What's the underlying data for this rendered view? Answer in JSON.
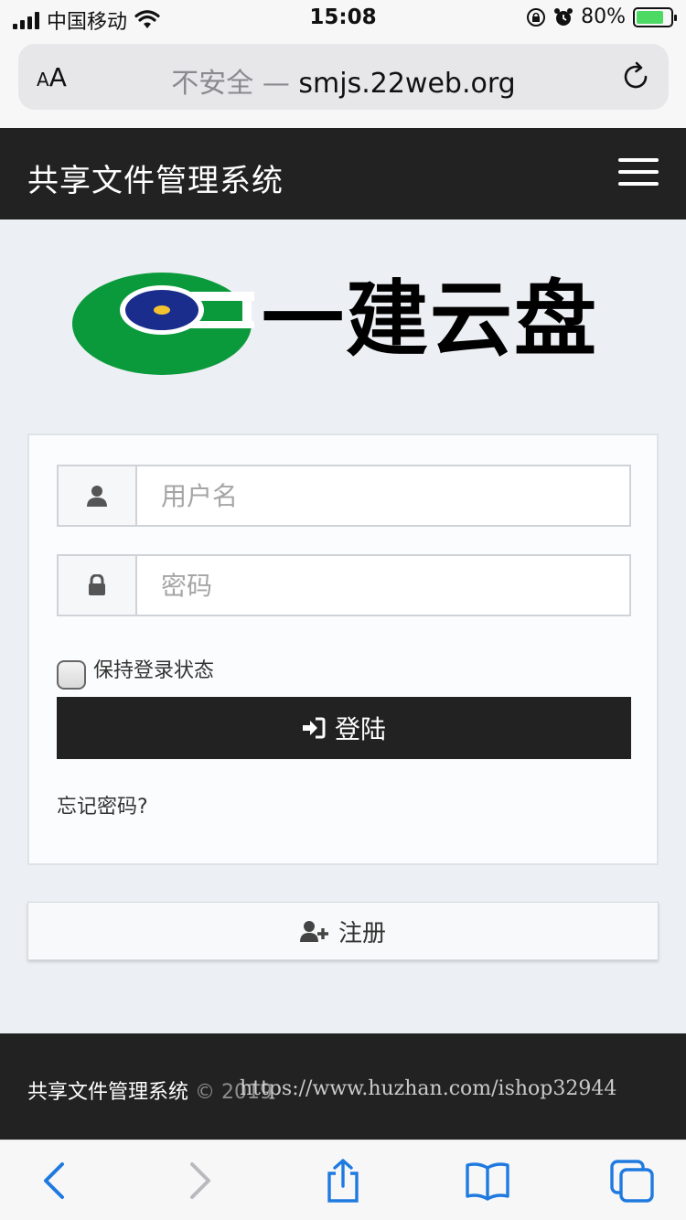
{
  "status_bar": {
    "carrier": "中国移动",
    "time": "15:08",
    "battery": "80%",
    "battery_level": 0.8
  },
  "browser": {
    "aa_small": "A",
    "aa_large": "A",
    "url_insecure": "不安全 — ",
    "url_domain": "smjs.22web.org"
  },
  "navbar": {
    "brand": "共享文件管理系统"
  },
  "logo": {
    "text": "一建云盘"
  },
  "login": {
    "username_placeholder": "用户名",
    "password_placeholder": "密码",
    "remember_label": "保持登录状态",
    "login_label": "登陆",
    "forgot_label": "忘记密码?"
  },
  "register": {
    "label": "注册"
  },
  "footer": {
    "title": "共享文件管理系统",
    "copyright": " © 2019",
    "watermark": "https://www.huzhan.com/ishop32944"
  },
  "colors": {
    "navbar_bg": "#222222",
    "logo_green": "#0a9a3b",
    "logo_blue": "#1a2d8c",
    "logo_yellow": "#f2c230",
    "ios_blue": "#1f7ae0"
  }
}
